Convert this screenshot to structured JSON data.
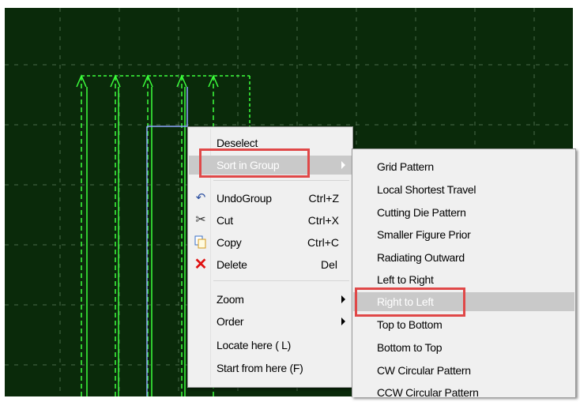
{
  "main_menu": {
    "items": [
      {
        "label": "Deselect",
        "enabled": true
      },
      {
        "label": "Sort in Group",
        "enabled": false,
        "submenu": true
      },
      {
        "label": "UndoGroup",
        "shortcut": "Ctrl+Z",
        "icon": "undo-icon"
      },
      {
        "label": "Cut",
        "shortcut": "Ctrl+X",
        "icon": "scissors-icon"
      },
      {
        "label": "Copy",
        "shortcut": "Ctrl+C",
        "icon": "copy-icon"
      },
      {
        "label": "Delete",
        "shortcut": "Del",
        "icon": "delete-x-icon"
      },
      {
        "label": "Zoom",
        "submenu": true
      },
      {
        "label": "Order",
        "submenu": true
      },
      {
        "label": "Locate here ( L)"
      },
      {
        "label": "Start from here (F)"
      }
    ]
  },
  "sub_menu": {
    "items": [
      "Grid Pattern",
      "Local Shortest Travel",
      "Cutting Die Pattern",
      "Smaller Figure Prior",
      "Radiating Outward",
      "Left to Right",
      "Right to Left",
      "Top to Bottom",
      "Bottom to Top",
      "CW Circular Pattern",
      "CCW Circular Pattern"
    ],
    "highlighted": "Right to Left"
  },
  "colors": {
    "canvas": "#0a2a0a",
    "grid": "#4a6a4a",
    "path": "#3cff3c",
    "highlight_box": "#e04848",
    "menu_bg": "#f0f0f0"
  }
}
